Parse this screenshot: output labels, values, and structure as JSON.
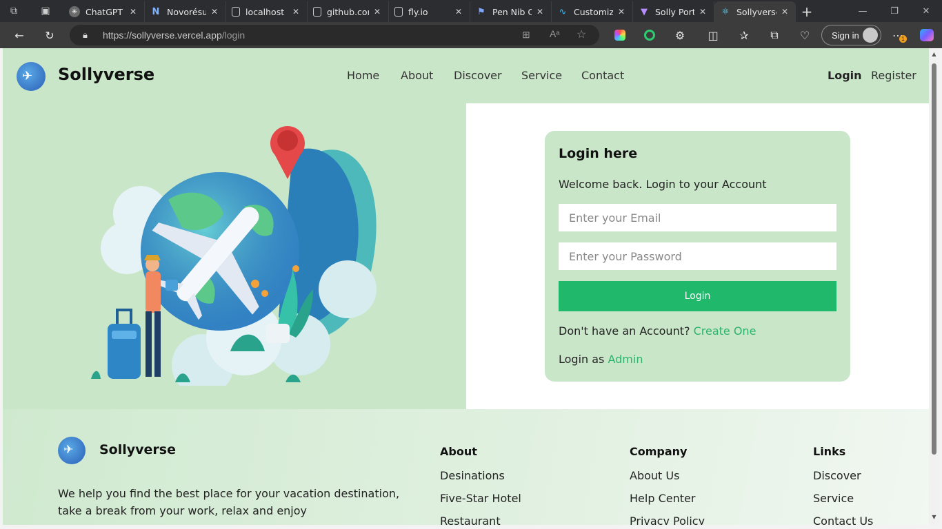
{
  "browser": {
    "tabs": [
      {
        "title": "ChatGPT",
        "icon": "chatgpt-icon"
      },
      {
        "title": "Novorésumé",
        "icon": "novoresume-icon"
      },
      {
        "title": "localhost",
        "icon": "page-icon"
      },
      {
        "title": "github.com",
        "icon": "page-icon"
      },
      {
        "title": "fly.io",
        "icon": "page-icon"
      },
      {
        "title": "Pen Nib C",
        "icon": "flag-icon"
      },
      {
        "title": "Customizi",
        "icon": "tailwind-icon"
      },
      {
        "title": "Solly Portf",
        "icon": "vite-icon"
      },
      {
        "title": "Sollyverse",
        "icon": "react-icon"
      }
    ],
    "active_tab_index": 8,
    "url": "https://sollyverse.vercel.app/login",
    "url_host": "https://sollyverse.vercel.app",
    "url_path": "/login",
    "signin_label": "Sign in",
    "notification_badge": "1"
  },
  "site": {
    "brand": "Sollyverse",
    "nav": [
      "Home",
      "About",
      "Discover",
      "Service",
      "Contact"
    ],
    "auth": {
      "login": "Login",
      "register": "Register"
    }
  },
  "login": {
    "heading": "Login here",
    "welcome": "Welcome back. Login to your Account",
    "email_placeholder": "Enter your Email",
    "password_placeholder": "Enter your Password",
    "button": "Login",
    "no_account_text": "Don't have an Account?",
    "create_link": "Create One",
    "admin_prefix": "Login as",
    "admin_link": "Admin"
  },
  "footer": {
    "brand": "Sollyverse",
    "tagline_line1": "We help you find the best place for your vacation destination,",
    "tagline_line2": "take a break from your work, relax and enjoy",
    "columns": [
      {
        "heading": "About",
        "items": [
          "Desinations",
          "Five-Star Hotel",
          "Restaurant"
        ]
      },
      {
        "heading": "Company",
        "items": [
          "About Us",
          "Help Center",
          "Privacy Policy"
        ]
      },
      {
        "heading": "Links",
        "items": [
          "Discover",
          "Service",
          "Contact Us"
        ]
      }
    ]
  },
  "colors": {
    "accent_green": "#20b96b",
    "link_green": "#2db36c",
    "page_green": "#c9e6c9"
  }
}
